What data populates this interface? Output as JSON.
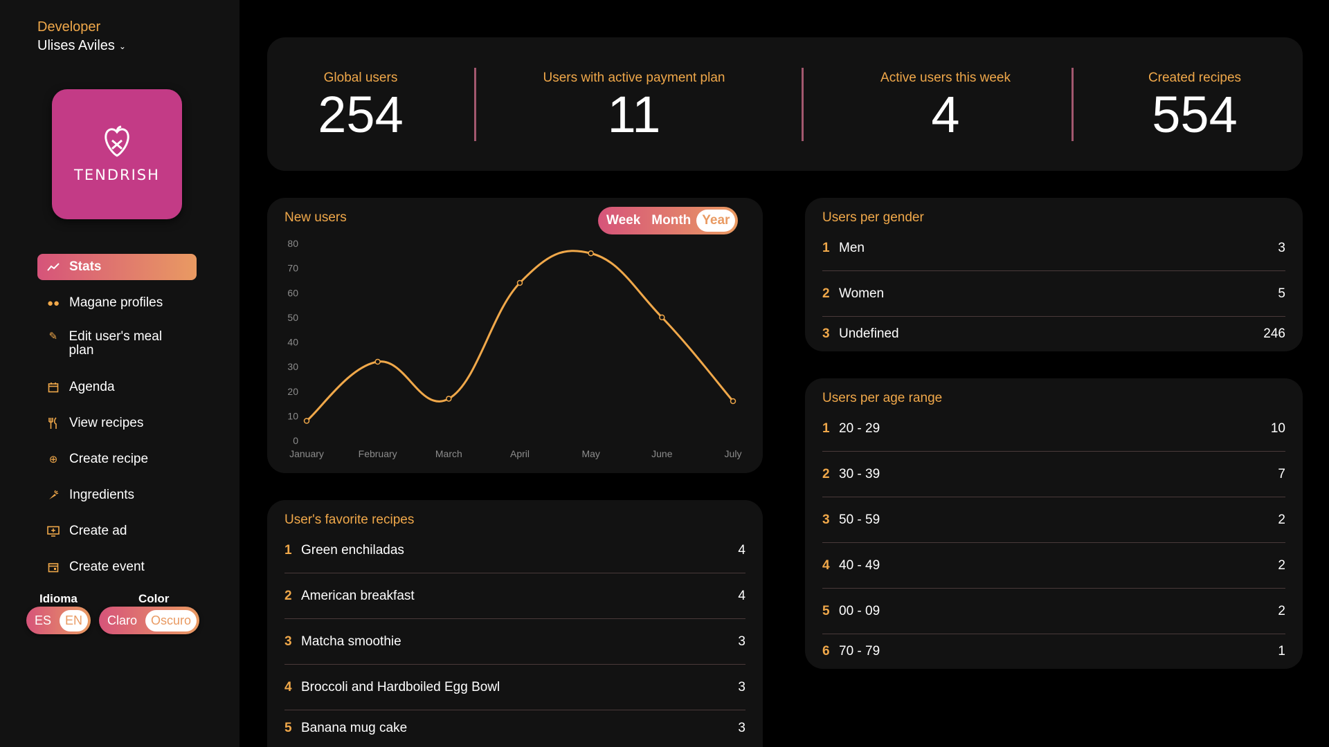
{
  "sidebar": {
    "role": "Developer",
    "user_name": "Ulises Aviles",
    "logo_text": "TENDRISH",
    "nav": [
      {
        "label": "Stats",
        "icon": "trending-up-icon"
      },
      {
        "label": "Magane profiles",
        "icon": "users-icon"
      },
      {
        "label": "Edit user's meal plan",
        "icon": "pencil-icon"
      },
      {
        "label": "Agenda",
        "icon": "calendar-icon"
      },
      {
        "label": "View recipes",
        "icon": "fork-knife-icon"
      },
      {
        "label": "Create recipe",
        "icon": "plus-circle-icon"
      },
      {
        "label": "Ingredients",
        "icon": "carrot-icon"
      },
      {
        "label": "Create ad",
        "icon": "ad-screen-icon"
      },
      {
        "label": "Create event",
        "icon": "event-calendar-icon"
      }
    ],
    "language": {
      "label": "Idioma",
      "options": [
        "ES",
        "EN"
      ],
      "selected": "EN"
    },
    "color": {
      "label": "Color",
      "options": [
        "Claro",
        "Oscuro"
      ],
      "selected": "Oscuro"
    }
  },
  "stats": [
    {
      "label": "Global users",
      "value": "254"
    },
    {
      "label": "Users with active payment plan",
      "value": "11"
    },
    {
      "label": "Active users this week",
      "value": "4"
    },
    {
      "label": "Created recipes",
      "value": "554"
    }
  ],
  "new_users": {
    "title": "New users",
    "ranges": [
      "Week",
      "Month",
      "Year"
    ],
    "selected_range": "Year"
  },
  "chart_data": {
    "type": "line",
    "title": "New users",
    "categories": [
      "January",
      "February",
      "March",
      "April",
      "May",
      "June",
      "July"
    ],
    "series": [
      {
        "values": [
          8,
          32,
          17,
          64,
          76,
          50,
          16
        ]
      }
    ],
    "yticks": [
      0,
      10,
      20,
      30,
      40,
      50,
      60,
      70,
      80
    ],
    "ylim": [
      0,
      80
    ],
    "grid": false,
    "color": "#f0a84a"
  },
  "favorite_recipes": {
    "title": "User's favorite recipes",
    "rows": [
      {
        "index": "1",
        "label": "Green enchiladas",
        "value": "4"
      },
      {
        "index": "2",
        "label": "American breakfast",
        "value": "4"
      },
      {
        "index": "3",
        "label": "Matcha smoothie",
        "value": "3"
      },
      {
        "index": "4",
        "label": "Broccoli and Hardboiled Egg Bowl",
        "value": "3"
      },
      {
        "index": "5",
        "label": "Banana mug cake",
        "value": "3"
      }
    ]
  },
  "gender": {
    "title": "Users per gender",
    "rows": [
      {
        "index": "1",
        "label": "Men",
        "value": "3"
      },
      {
        "index": "2",
        "label": "Women",
        "value": "5"
      },
      {
        "index": "3",
        "label": "Undefined",
        "value": "246"
      }
    ]
  },
  "age": {
    "title": "Users per age range",
    "rows": [
      {
        "index": "1",
        "label": "20 - 29",
        "value": "10"
      },
      {
        "index": "2",
        "label": "30 - 39",
        "value": "7"
      },
      {
        "index": "3",
        "label": "50 - 59",
        "value": "2"
      },
      {
        "index": "4",
        "label": "40 - 49",
        "value": "2"
      },
      {
        "index": "5",
        "label": "00 - 09",
        "value": "2"
      },
      {
        "index": "6",
        "label": "70 - 79",
        "value": "1"
      }
    ]
  },
  "colors": {
    "accent": "#f0a84a",
    "brand": "#c33b86",
    "gradient_start": "#d6547a",
    "gradient_end": "#e99a62"
  }
}
